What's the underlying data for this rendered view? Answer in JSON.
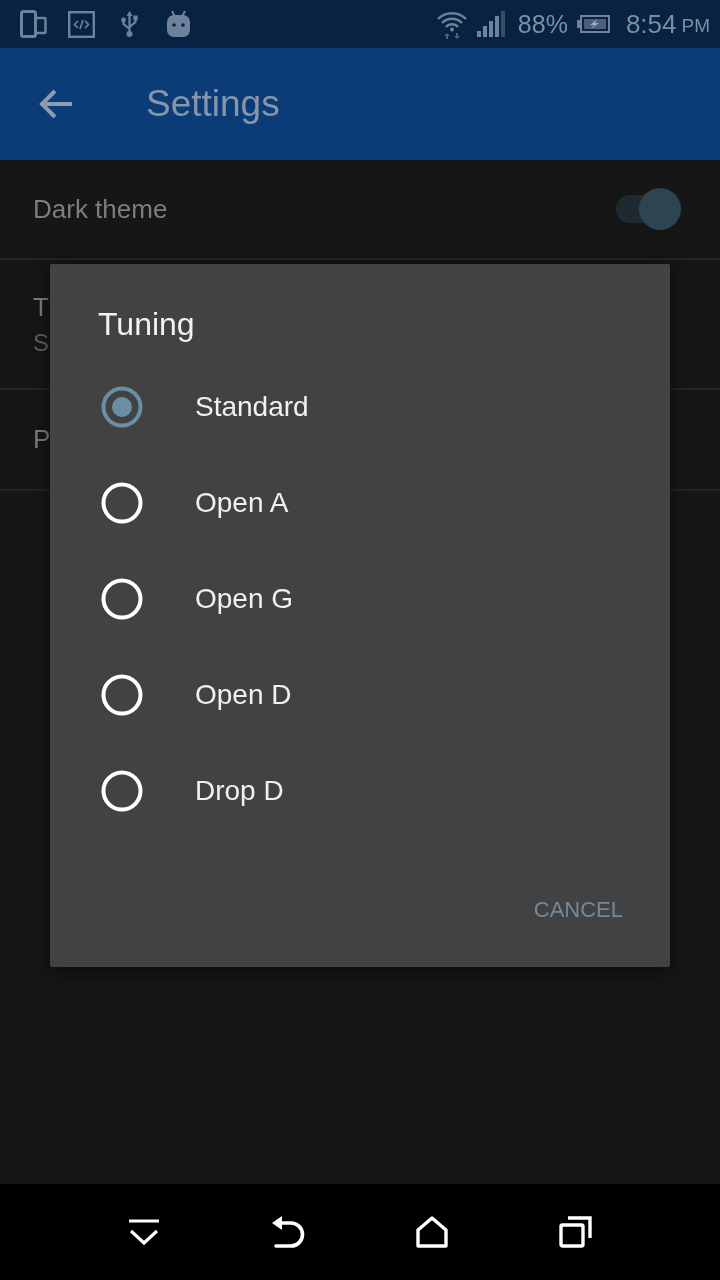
{
  "status_bar": {
    "battery": "88%",
    "time": "8:54",
    "period": "PM"
  },
  "app_bar": {
    "title": "Settings"
  },
  "settings": [
    {
      "kind": "switch",
      "title": "Dark theme",
      "on": true
    },
    {
      "kind": "value",
      "title": "T",
      "summary": "S"
    },
    {
      "kind": "plain",
      "title": "P"
    }
  ],
  "dialog": {
    "title": "Tuning",
    "options": [
      {
        "label": "Standard",
        "selected": true
      },
      {
        "label": "Open A",
        "selected": false
      },
      {
        "label": "Open G",
        "selected": false
      },
      {
        "label": "Open D",
        "selected": false
      },
      {
        "label": "Drop D",
        "selected": false
      }
    ],
    "buttons": [
      "CANCEL"
    ]
  }
}
